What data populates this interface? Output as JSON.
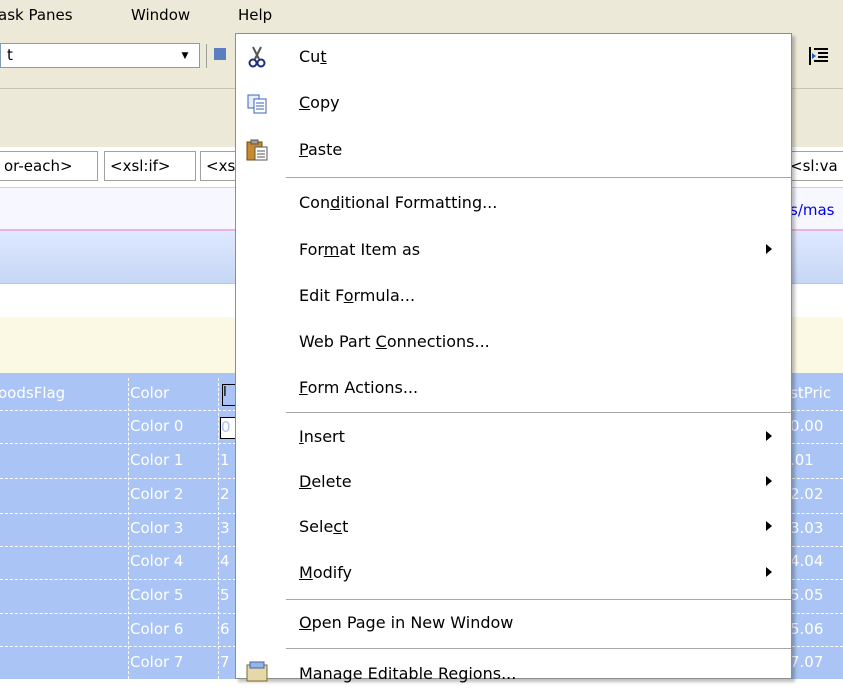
{
  "menubar": {
    "items": [
      {
        "label": "ask Panes",
        "mnemonic_index": 2
      },
      {
        "label": "Window",
        "mnemonic_index": 0
      },
      {
        "label": "Help",
        "mnemonic_index": 0
      }
    ]
  },
  "toolbar": {
    "font_value": "t"
  },
  "tagbar": {
    "tags": [
      "or-each>",
      "<xsl:if>",
      "<xs",
      "<sl:va"
    ]
  },
  "address": {
    "text": "s/mas"
  },
  "table": {
    "headers": {
      "left": "oodsFlag",
      "color": "Color",
      "num": "I",
      "price": "stPric"
    },
    "rows": [
      {
        "color": "Color 0",
        "num": "0",
        "price": "0.00"
      },
      {
        "color": "Color 1",
        "num": "1",
        "price": ".01"
      },
      {
        "color": "Color 2",
        "num": "2",
        "price": "2.02"
      },
      {
        "color": "Color 3",
        "num": "3",
        "price": "3.03"
      },
      {
        "color": "Color 4",
        "num": "4",
        "price": "4.04"
      },
      {
        "color": "Color 5",
        "num": "5",
        "price": "5.05"
      },
      {
        "color": "Color 6",
        "num": "6",
        "price": "5.06"
      },
      {
        "color": "Color 7",
        "num": "7",
        "price": "7.07"
      }
    ]
  },
  "context_menu": {
    "items": [
      {
        "pre": "Cu",
        "mn": "t",
        "post": "",
        "icon": "scissors-icon",
        "submenu": false
      },
      {
        "pre": "",
        "mn": "C",
        "post": "opy",
        "icon": "copy-icon",
        "submenu": false
      },
      {
        "pre": "",
        "mn": "P",
        "post": "aste",
        "icon": "paste-icon",
        "submenu": false
      },
      {
        "pre": "Con",
        "mn": "d",
        "post": "itional Formatting...",
        "icon": "",
        "submenu": false
      },
      {
        "pre": "For",
        "mn": "m",
        "post": "at Item as",
        "icon": "",
        "submenu": true
      },
      {
        "pre": "Edit F",
        "mn": "o",
        "post": "rmula...",
        "icon": "",
        "submenu": false
      },
      {
        "pre": "Web Part ",
        "mn": "C",
        "post": "onnections...",
        "icon": "",
        "submenu": false
      },
      {
        "pre": "",
        "mn": "F",
        "post": "orm Actions...",
        "icon": "",
        "submenu": false
      },
      {
        "pre": "",
        "mn": "I",
        "post": "nsert",
        "icon": "",
        "submenu": true
      },
      {
        "pre": "",
        "mn": "D",
        "post": "elete",
        "icon": "",
        "submenu": true
      },
      {
        "pre": "Sele",
        "mn": "c",
        "post": "t",
        "icon": "",
        "submenu": true
      },
      {
        "pre": "",
        "mn": "M",
        "post": "odify",
        "icon": "",
        "submenu": true
      },
      {
        "pre": "",
        "mn": "O",
        "post": "pen Page in New Window",
        "icon": "",
        "submenu": false
      },
      {
        "pre": "Manage Editable Regions...",
        "mn": "",
        "post": "",
        "icon": "regions-icon",
        "submenu": false
      }
    ]
  },
  "colors": {
    "chrome": "#ece9d8",
    "table_selection": "#a9c4f5",
    "link": "#0000ee",
    "menu_separator": "#a6a6a6"
  }
}
